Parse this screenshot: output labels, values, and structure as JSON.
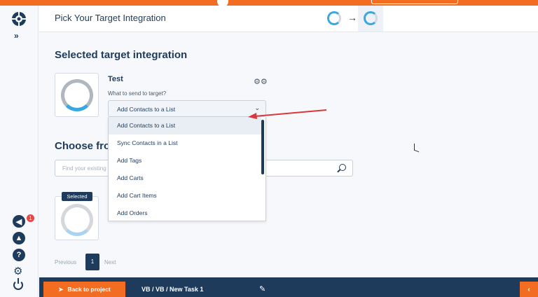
{
  "header": {
    "title": "Pick Your Target Integration"
  },
  "target": {
    "section_title": "Selected target integration",
    "name": "Test",
    "send_label": "What to send to target?",
    "selected_option": "Add Contacts to a List",
    "options": [
      "Add Contacts to a List",
      "Sync Contacts in a List",
      "Add Tags",
      "Add Carts",
      "Add Cart Items",
      "Add Orders"
    ]
  },
  "choose": {
    "title": "Choose fro",
    "search_placeholder": "Find your existing",
    "selected_badge": "Selected"
  },
  "pager": {
    "previous": "Previous",
    "current_page": "1",
    "next": "Next"
  },
  "sidebar": {
    "expand": "»",
    "notification_count": "1"
  },
  "footer": {
    "back_label": "Back to project",
    "path": "VB / VB / New Task 1"
  },
  "colors": {
    "accent_orange": "#f26d21",
    "navy": "#1f3b5c",
    "blue": "#3aa8e0",
    "annotation_red": "#d9393a"
  },
  "icons": {
    "logo": "brand-logo-icon",
    "expand": "double-chevron-right-icon",
    "notifications": "megaphone-icon",
    "rocket": "rocket-icon",
    "help": "question-icon",
    "settings": "gear-icon",
    "power": "power-icon",
    "step_arrow": "arrow-right-icon",
    "integration_settings": "gears-icon",
    "dropdown_chevron": "chevron-down-icon",
    "search": "search-icon",
    "back": "rocket-icon",
    "edit": "pencil-icon",
    "collapse": "chevron-left-icon"
  }
}
